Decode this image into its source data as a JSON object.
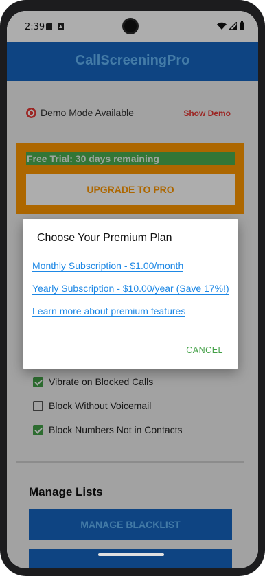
{
  "status_bar": {
    "time": "2:39"
  },
  "app_bar": {
    "title": "CallScreeningPro"
  },
  "demo": {
    "label": "Demo Mode Available",
    "action": "Show Demo"
  },
  "trial": {
    "text": "Free Trial: 30 days remaining",
    "upgrade_label": "UPGRADE TO PRO"
  },
  "settings": {
    "options": [
      {
        "label": "Vibrate on Blocked Calls",
        "checked": true
      },
      {
        "label": "Block Without Voicemail",
        "checked": false
      },
      {
        "label": "Block Numbers Not in Contacts",
        "checked": true
      }
    ]
  },
  "lists": {
    "title": "Manage Lists",
    "blacklist_label": "MANAGE BLACKLIST"
  },
  "dialog": {
    "title": "Choose Your Premium Plan",
    "plans": [
      "Monthly Subscription - $1.00/month",
      "Yearly Subscription - $10.00/year (Save 17%!)",
      "Learn more about premium features"
    ],
    "cancel_label": "CANCEL"
  },
  "colors": {
    "primary": "#1565c0",
    "accent": "#ff9800",
    "success": "#43a047",
    "link": "#1e88e5",
    "danger": "#e53935"
  }
}
